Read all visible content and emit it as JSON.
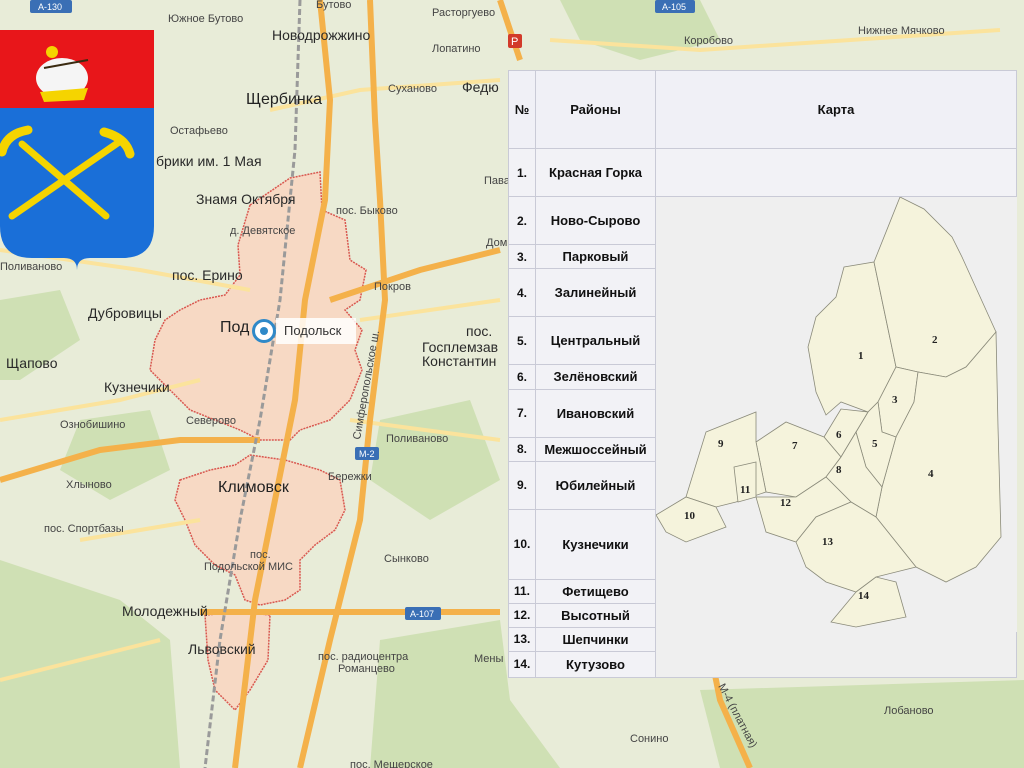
{
  "map": {
    "places": {
      "yuzhnoe_butovo": "Южное Бутово",
      "butovo": "Бутово",
      "rastorguevo": "Расторгуево",
      "novodrozhzhino": "Новодрожжино",
      "lopatino": "Лопатино",
      "korobovo": "Коробово",
      "nizhnee_myachkovo": "Нижнее Мячково",
      "shcherbinka": "Щербинка",
      "sukhanovo": "Суханово",
      "fedyuk": "Федю",
      "ostafyevo": "Остафьево",
      "fabriki": "брики им. 1 Мая",
      "znamya": "Знамя Октября",
      "pos_bykovo": "пос. Быково",
      "devyatskoe": "д. Девятское",
      "pava": "Пава",
      "dom": "Дом",
      "polivanovo_w": "Поливаново",
      "pos_erino": "пос. Ерино",
      "pokrov": "Покров",
      "dubrovitsy": "Дубровицы",
      "podol_cut": "Под",
      "podolsk": "Подольск",
      "pos": "пос.",
      "gosplemzav": "Госплемзав",
      "konstantin": "Константин",
      "shchapovo": "Щапово",
      "kuznechiki": "Кузнечики",
      "oznobishino": "Ознобишино",
      "severovo": "Северово",
      "simferopolskoe": "Симферопольское ш.",
      "polivanovo_e": "Поливаново",
      "berezhki": "Бережки",
      "khlynovo": "Хлыново",
      "klimovsk": "Климовск",
      "pos_sportbazy": "пос. Спортбазы",
      "pos_mis": "пос.",
      "podolskoy_mis": "Подольской МИС",
      "synkovo": "Сынково",
      "molodezhny": "Молодежный",
      "lvovsky": "Львовский",
      "pos_radio": "пос. радиоцентра",
      "romantsevo": "Романцево",
      "meny": "Мены",
      "sonino": "Сонино",
      "lobanovo": "Лобаново",
      "m4_paid": "М-4 (платная)",
      "pos_meshcher": "пос. Мещерское"
    },
    "roads": {
      "a130": "А-130",
      "a105": "А-105",
      "a107": "А-107",
      "m2": "М-2"
    },
    "colors": {
      "background": "#e8ecd8",
      "forest": "#cfe0b4",
      "road_major": "#f4b14a",
      "road_minor": "#fbe39c",
      "city_fill": "#f7d9c4",
      "city_border": "#d9574f",
      "rail": "#9a9a9a"
    }
  },
  "coat_of_arms": {
    "icon": "coat-of-arms-icon",
    "colors": {
      "top": "#e8161a",
      "bottom": "#1a6fd8",
      "tools": "#f5d400"
    }
  },
  "popup": {
    "label": "Подольск"
  },
  "table": {
    "headers": {
      "num": "№",
      "districts": "Районы",
      "map": "Карта"
    },
    "rows": [
      {
        "num": "1.",
        "name": "Красная Горка"
      },
      {
        "num": "2.",
        "name": "Ново-Сырово"
      },
      {
        "num": "3.",
        "name": "Парковый"
      },
      {
        "num": "4.",
        "name": "Залинейный"
      },
      {
        "num": "5.",
        "name": "Центральный"
      },
      {
        "num": "6.",
        "name": "Зелёновский"
      },
      {
        "num": "7.",
        "name": "Ивановский"
      },
      {
        "num": "8.",
        "name": "Межшоссейный"
      },
      {
        "num": "9.",
        "name": "Юбилейный"
      },
      {
        "num": "10.",
        "name": "Кузнечики"
      },
      {
        "num": "11.",
        "name": "Фетищево"
      },
      {
        "num": "12.",
        "name": "Высотный"
      },
      {
        "num": "13.",
        "name": "Шепчинки"
      },
      {
        "num": "14.",
        "name": "Кутузово"
      }
    ],
    "district_numbers": [
      "1",
      "2",
      "3",
      "4",
      "5",
      "6",
      "7",
      "8",
      "9",
      "10",
      "11",
      "12",
      "13",
      "14"
    ]
  }
}
